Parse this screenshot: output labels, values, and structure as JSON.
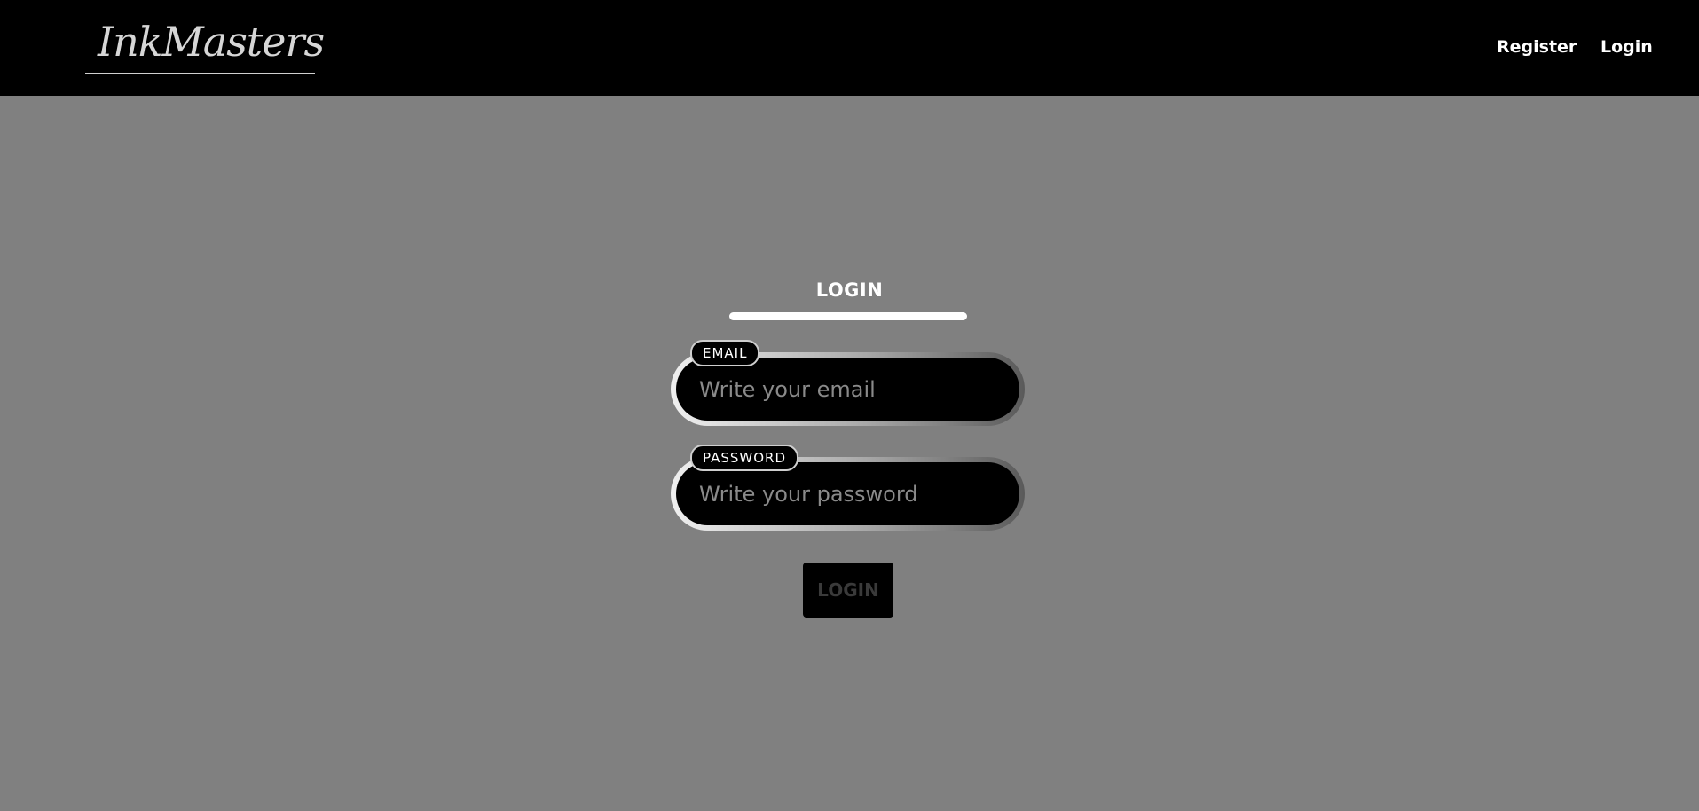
{
  "navbar": {
    "logo_text": "InkMasters",
    "links": {
      "register": "Register",
      "login": "Login"
    }
  },
  "form": {
    "title": "LOGIN",
    "email": {
      "label": "EMAIL",
      "placeholder": "Write your email",
      "value": ""
    },
    "password": {
      "label": "PASSWORD",
      "placeholder": "Write your password",
      "value": ""
    },
    "submit_label": "LOGIN"
  },
  "colors": {
    "background": "#808080",
    "navbar": "#000000",
    "text": "#ffffff",
    "button_disabled_text": "#3a3a3a"
  }
}
